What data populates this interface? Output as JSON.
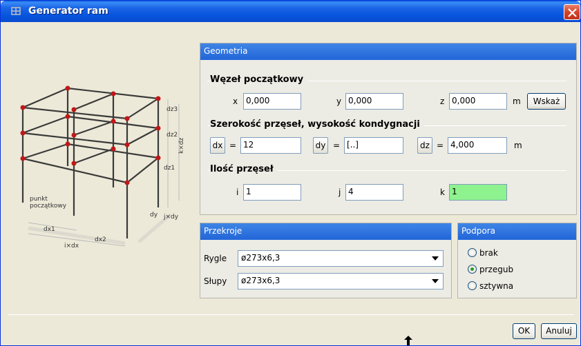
{
  "window": {
    "title": "Generator ram",
    "close_icon": "close-icon"
  },
  "diagram": {
    "labels": {
      "dz3": "dz3",
      "dz2": "dz2",
      "dz1": "dz1",
      "kdz": "k×dz",
      "punkt": "punkt",
      "poczatkowy": "początkowy",
      "dy": "dy",
      "jdy": "j×dy",
      "dx1": "dx1",
      "dx2": "dx2",
      "idx": "i×dx"
    }
  },
  "geometria": {
    "header": "Geometria",
    "wezel": {
      "title": "Węzeł początkowy",
      "x_label": "x",
      "x_value": "0,000",
      "y_label": "y",
      "y_value": "0,000",
      "z_label": "z",
      "z_value": "0,000",
      "unit": "m",
      "wskaz_label": "Wskaż"
    },
    "szerokosc": {
      "title": "Szerokość przęseł, wysokość kondygnacji",
      "dx_label": "dx",
      "dx_value": "12",
      "dy_label": "dy",
      "dy_value": "[..]",
      "dz_label": "dz",
      "dz_value": "4,000",
      "eq": "=",
      "unit": "m"
    },
    "ilosc": {
      "title": "Ilość przęseł",
      "i_label": "i",
      "i_value": "1",
      "j_label": "j",
      "j_value": "4",
      "k_label": "k",
      "k_value": "1"
    }
  },
  "przekroje": {
    "header": "Przekroje",
    "rygle_label": "Rygle",
    "rygle_value": "ø273x6,3",
    "slupy_label": "Słupy",
    "slupy_value": "ø273x6,3"
  },
  "podpora": {
    "header": "Podpora",
    "options": [
      "brak",
      "przegub",
      "sztywna"
    ],
    "selected": "przegub"
  },
  "footer": {
    "ok_label": "OK",
    "anuluj_label": "Anuluj"
  },
  "colors": {
    "title_blue": "#0a5fe0",
    "header_blue": "#2265d8",
    "highlight_green": "#8ef28e"
  }
}
